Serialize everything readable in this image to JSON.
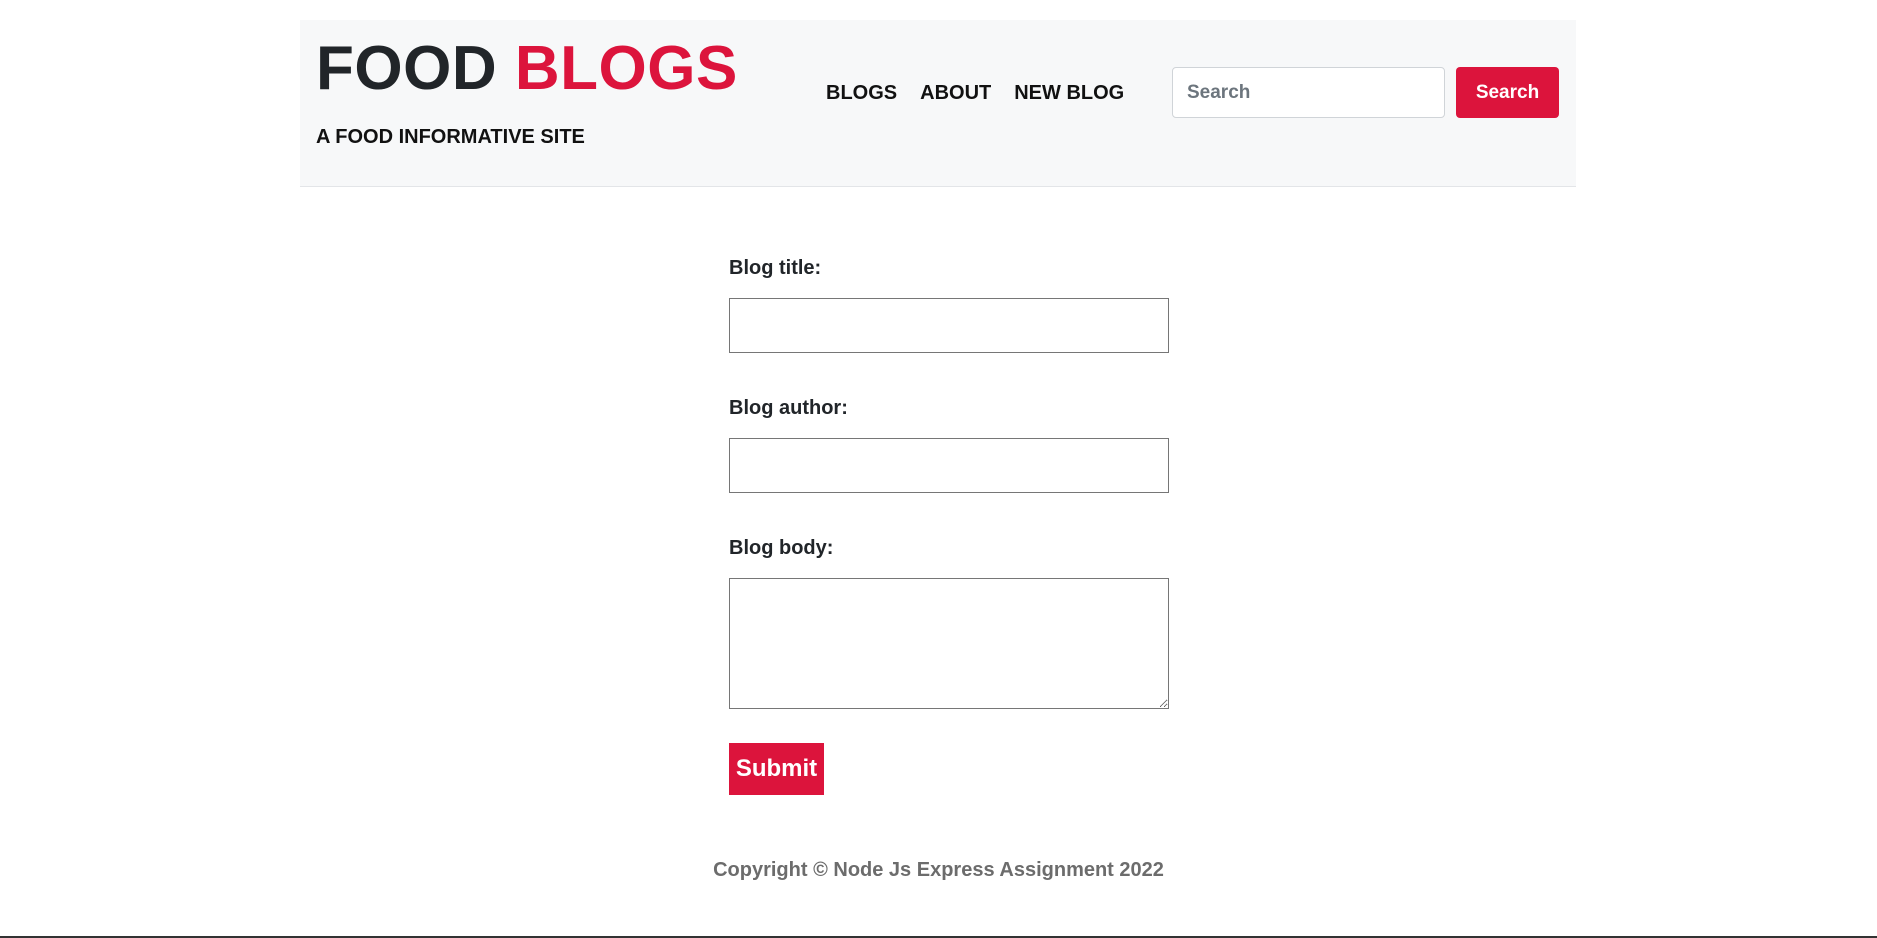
{
  "header": {
    "brand_word1": "FOOD",
    "brand_word2": "BLOGS",
    "tagline": "A FOOD INFORMATIVE SITE",
    "nav": [
      {
        "label": "BLOGS"
      },
      {
        "label": "ABOUT"
      },
      {
        "label": "NEW BLOG"
      }
    ],
    "search": {
      "placeholder": "Search",
      "value": "",
      "button_label": "Search"
    }
  },
  "form": {
    "title_label": "Blog title:",
    "title_value": "",
    "author_label": "Blog author:",
    "author_value": "",
    "body_label": "Blog body:",
    "body_value": "",
    "submit_label": "Submit"
  },
  "footer": {
    "text": "Copyright © Node Js Express Assignment 2022"
  },
  "colors": {
    "accent": "#dc143c",
    "header_bg": "#f7f8f9",
    "text": "#212529",
    "footer_text": "#6c6c6c"
  }
}
